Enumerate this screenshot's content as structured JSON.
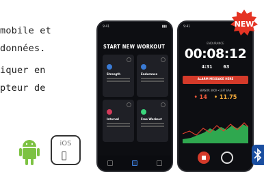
{
  "text_lines": [
    "mobile et",
    "données.",
    "iquer  en",
    "pteur  de"
  ],
  "badge": "NEW",
  "phone1": {
    "title": "START NEW WORKOUT",
    "cards": [
      {
        "label": "Strength",
        "color": "#3a7bd5"
      },
      {
        "label": "Endurance",
        "color": "#3a7bd5"
      },
      {
        "label": "Interval",
        "color": "#d43a5a"
      },
      {
        "label": "Free Workout",
        "color": "#3ad57b"
      }
    ]
  },
  "phone2": {
    "label": "ENDURANCE",
    "timer": "00:08:12",
    "stats": [
      "4:31",
      "63"
    ],
    "alarm": "ALARM MESSAGE HERE",
    "sensor": "SENSOR 3000 • LEFT EAR",
    "value_a": "• 14",
    "value_b": "• 11.75"
  },
  "ios_label": "iOS"
}
